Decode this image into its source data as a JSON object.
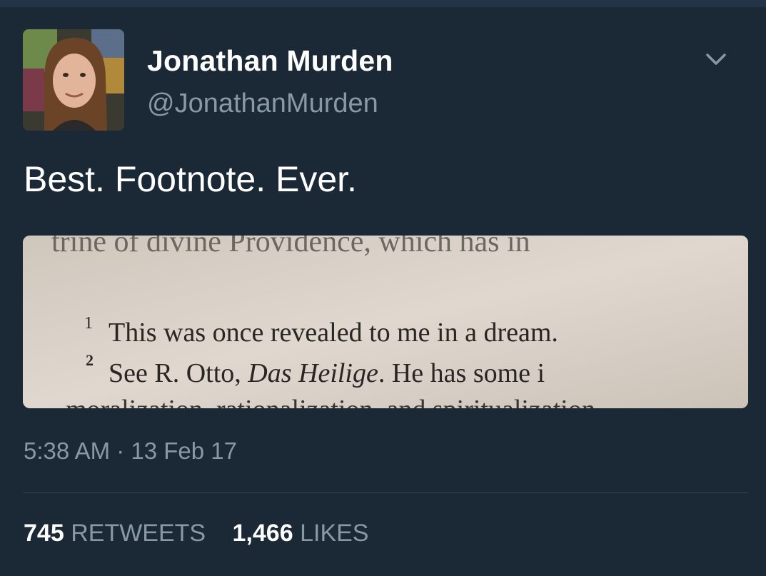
{
  "tweet": {
    "author": {
      "display_name": "Jonathan Murden",
      "handle": "@JonathanMurden"
    },
    "text": "Best. Footnote. Ever.",
    "media": {
      "top_line": "trine of divine Providence, which has in",
      "footnote_1_marker": "1",
      "footnote_1": "This was once revealed to me in a dream.",
      "footnote_2_marker": "2",
      "footnote_2_prefix": "See R. Otto, ",
      "footnote_2_italic": "Das Heilige",
      "footnote_2_suffix": ". He has some i",
      "bottom_line": "moralization, rationalization, and spiritualization"
    },
    "timestamp": "5:38 AM · 13 Feb 17",
    "retweets": {
      "count": "745",
      "label": "RETWEETS"
    },
    "likes": {
      "count": "1,466",
      "label": "LIKES"
    }
  },
  "icons": {
    "menu": "chevron-down-icon"
  },
  "colors": {
    "background": "#1b2836",
    "primary_text": "#ffffff",
    "secondary_text": "#8899a6",
    "divider": "#38444d"
  }
}
